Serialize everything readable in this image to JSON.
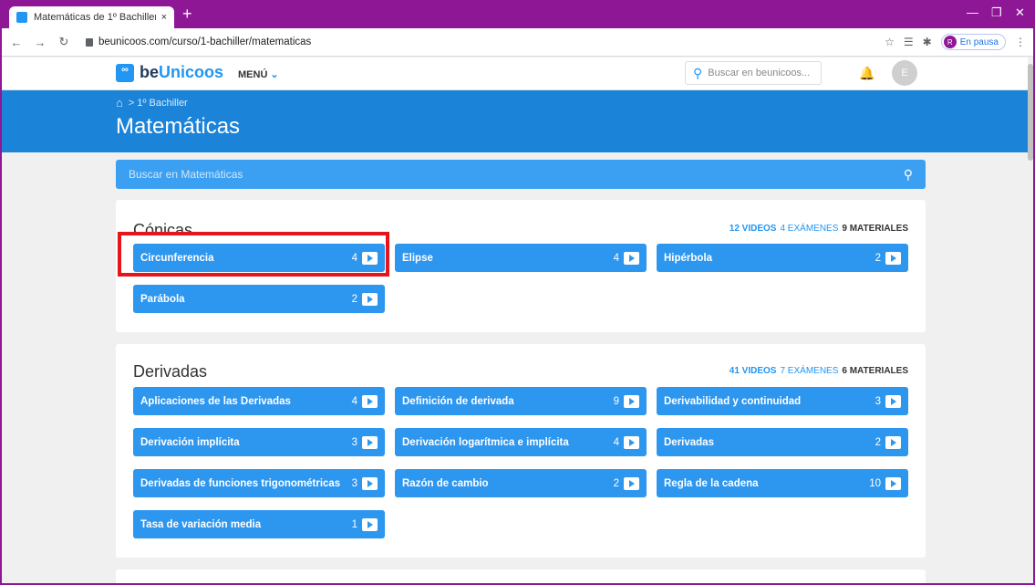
{
  "browser": {
    "tab_title": "Matemáticas de 1º Bachiller - be",
    "tab_close": "×",
    "new_tab": "+",
    "url": "beunicoos.com/curso/1-bachiller/matematicas",
    "profile_initial": "R",
    "profile_status": "En pausa"
  },
  "site": {
    "logo_mark": "ºº",
    "logo_prefix": "be",
    "logo_name": "Unicoos",
    "menu_label": "MENÚ",
    "search_placeholder": "Buscar en beunicoos...",
    "user_initial": "E"
  },
  "hero": {
    "breadcrumb_course": "1º Bachiller",
    "title": "Matemáticas"
  },
  "topic_search": {
    "placeholder": "Buscar en Matemáticas"
  },
  "sections": [
    {
      "title": "Cónicas",
      "videos": "12 VIDEOS",
      "exams": "4 EXÁMENES",
      "materials": "9 MATERIALES",
      "topics": [
        {
          "label": "Circunferencia",
          "count": "4"
        },
        {
          "label": "Elipse",
          "count": "4"
        },
        {
          "label": "Hipérbola",
          "count": "2"
        },
        {
          "label": "Parábola",
          "count": "2"
        }
      ]
    },
    {
      "title": "Derivadas",
      "videos": "41 VIDEOS",
      "exams": "7 EXÁMENES",
      "materials": "6 MATERIALES",
      "topics": [
        {
          "label": "Aplicaciones de las Derivadas",
          "count": "4"
        },
        {
          "label": "Definición de derivada",
          "count": "9"
        },
        {
          "label": "Derivabilidad y continuidad",
          "count": "3"
        },
        {
          "label": "Derivación implícita",
          "count": "3"
        },
        {
          "label": "Derivación logarítmica e implícita",
          "count": "4"
        },
        {
          "label": "Derivadas",
          "count": "2"
        },
        {
          "label": "Derivadas de funciones trigonométricas",
          "count": "3"
        },
        {
          "label": "Razón de cambio",
          "count": "2"
        },
        {
          "label": "Regla de la cadena",
          "count": "10"
        },
        {
          "label": "Tasa de variación media",
          "count": "1"
        }
      ]
    }
  ]
}
